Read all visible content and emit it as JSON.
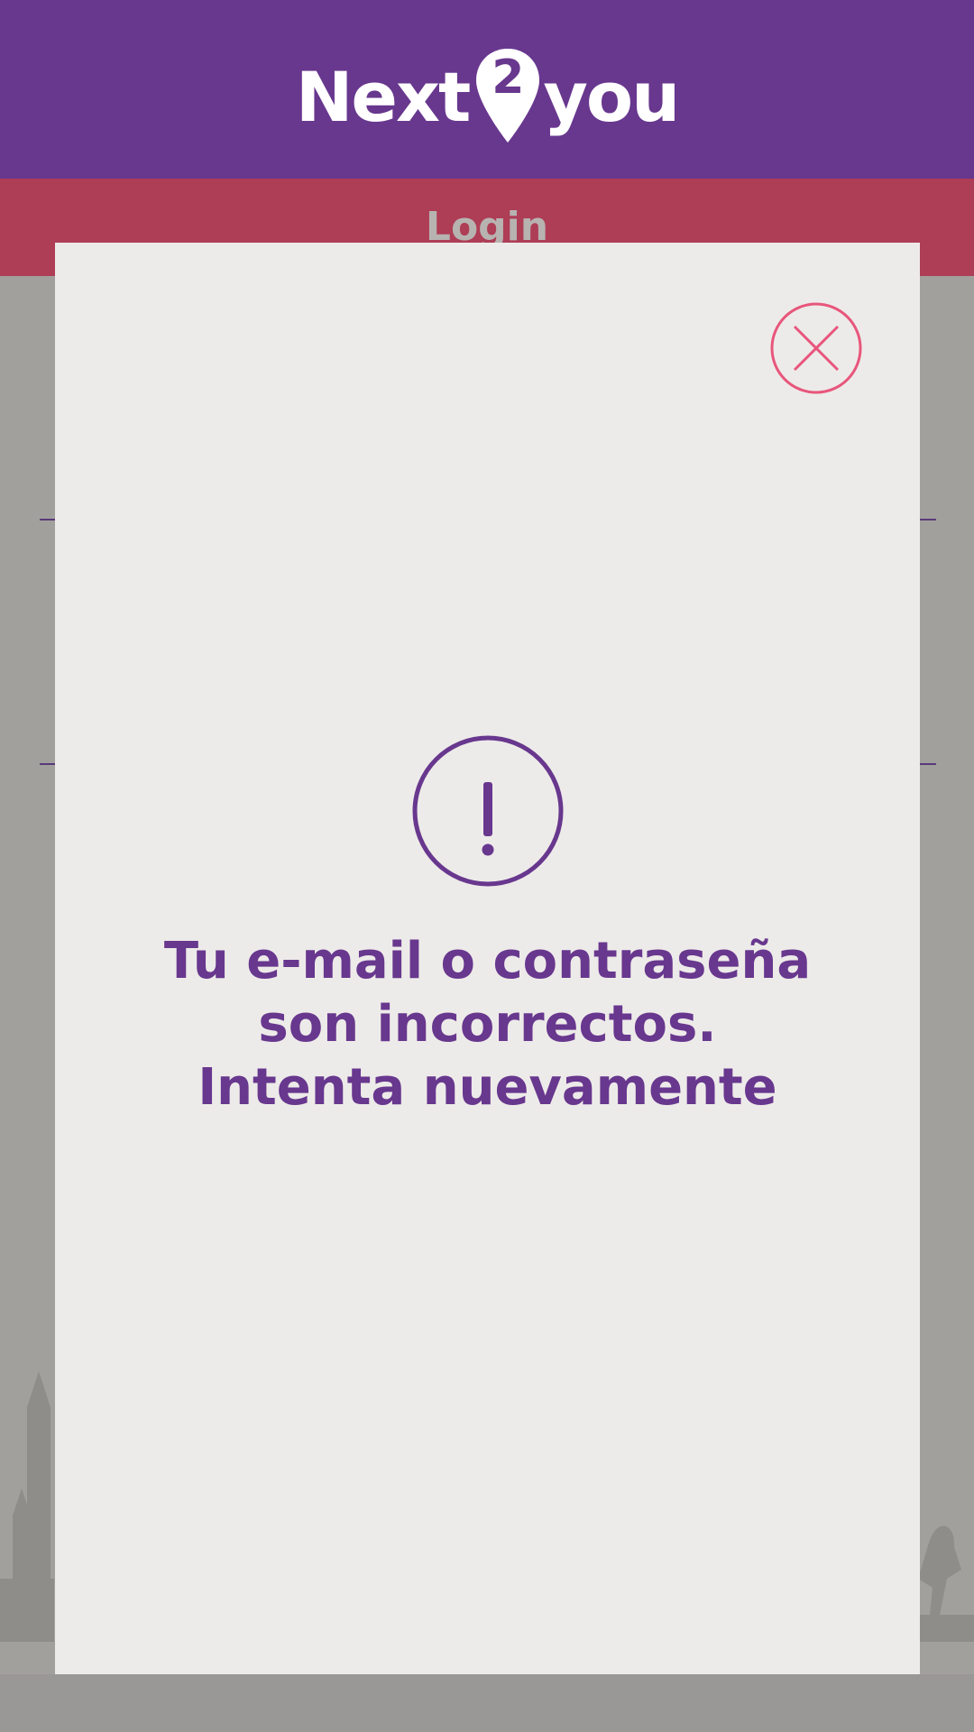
{
  "header": {
    "logo": {
      "part1": "Next",
      "pin_digit": "2",
      "part2": "you"
    }
  },
  "login_bar": {
    "label": "Login"
  },
  "dialog": {
    "close_icon": "close-icon",
    "alert_icon": "exclamation-icon",
    "message_lines": [
      "Tu e-mail o contraseña",
      "son incorrectos.",
      "Intenta nuevamente"
    ]
  },
  "colors": {
    "brand_purple": "#68378e",
    "login_bar": "#ae3d56",
    "close_pink": "#e8567c",
    "overlay_gray": "#a2a09d",
    "dialog_bg": "#edebe9"
  }
}
